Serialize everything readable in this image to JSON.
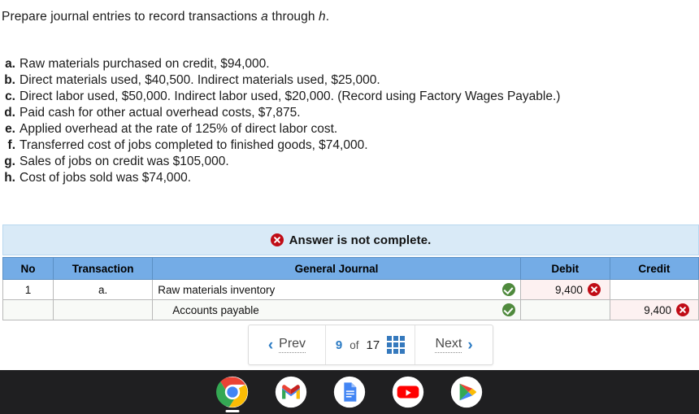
{
  "prompt": {
    "before": "Prepare journal entries to record transactions ",
    "italic_a": "a",
    "middle": " through ",
    "italic_h": "h",
    "after": "."
  },
  "transactions": [
    {
      "label": "a.",
      "text": "Raw materials purchased on credit, $94,000."
    },
    {
      "label": "b.",
      "text": "Direct materials used, $40,500. Indirect materials used, $25,000."
    },
    {
      "label": "c.",
      "text": "Direct labor used, $50,000. Indirect labor used, $20,000. (Record using Factory Wages Payable.)"
    },
    {
      "label": "d.",
      "text": "Paid cash for other actual overhead costs, $7,875."
    },
    {
      "label": "e.",
      "text": "Applied overhead at the rate of 125% of direct labor cost."
    },
    {
      "label": "f.",
      "text": "Transferred cost of jobs completed to finished goods, $74,000."
    },
    {
      "label": "g.",
      "text": "Sales of jobs on credit was $105,000."
    },
    {
      "label": "h.",
      "text": "Cost of jobs sold was $74,000."
    }
  ],
  "banner": {
    "icon": "error-x-icon",
    "text": "Answer is not complete.",
    "background_color": "#d9eaf7",
    "icon_color": "#c00c16"
  },
  "table": {
    "headers": [
      "No",
      "Transaction",
      "General Journal",
      "Debit",
      "Credit"
    ],
    "header_color": "#74ace6",
    "rows": [
      {
        "no": "1",
        "transaction": "a.",
        "account": "Raw materials inventory",
        "indented": false,
        "account_status": "correct",
        "debit": "9,400",
        "debit_status": "incorrect",
        "credit": "",
        "credit_status": ""
      },
      {
        "no": "",
        "transaction": "",
        "account": "Accounts payable",
        "indented": true,
        "account_status": "correct",
        "debit": "",
        "debit_status": "",
        "credit": "9,400",
        "credit_status": "incorrect"
      }
    ]
  },
  "pager": {
    "prev_label": "Prev",
    "prev_icon": "chevron-left-icon",
    "current_page": "9",
    "of_label": "of",
    "total_pages": "17",
    "grid_icon": "grid-view-icon",
    "next_label": "Next",
    "next_icon": "chevron-right-icon",
    "accent_color": "#2b7bc4"
  },
  "shelf": {
    "apps": [
      {
        "name": "chrome-app-icon",
        "active": true
      },
      {
        "name": "gmail-app-icon",
        "active": false
      },
      {
        "name": "google-docs-app-icon",
        "active": false
      },
      {
        "name": "youtube-app-icon",
        "active": false
      },
      {
        "name": "play-store-app-icon",
        "active": false
      }
    ],
    "background_color": "#1f1f21"
  }
}
